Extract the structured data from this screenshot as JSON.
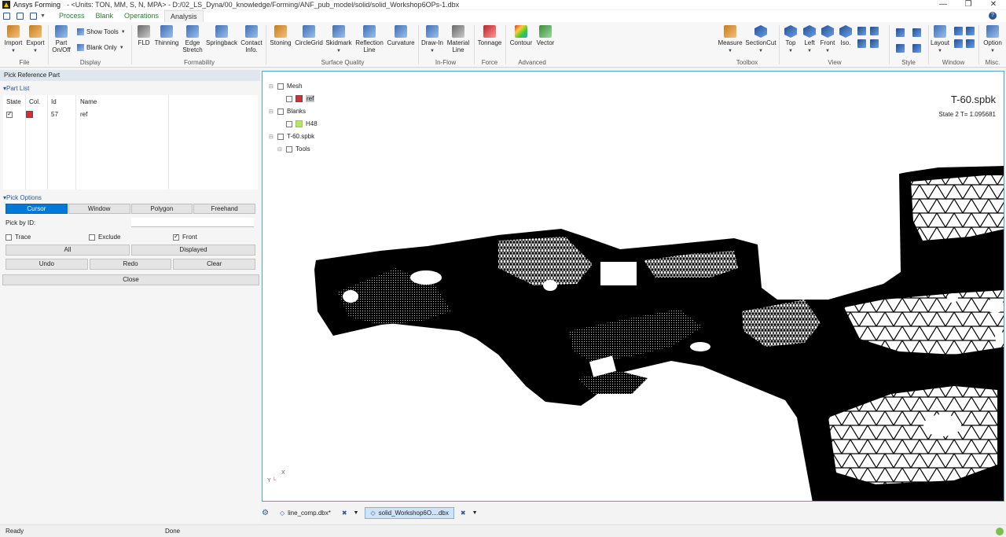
{
  "window": {
    "app_name": "Ansys Forming",
    "title_path": "- <Units: TON, MM, S, N, MPA> - D:/02_LS_Dyna/00_knowledge/Forming/ANF_pub_model/solid/solid_Workshop6OPs-1.dbx",
    "controls": [
      "—",
      "❐",
      "✕"
    ]
  },
  "menu": {
    "tabs": [
      "Process",
      "Blank",
      "Operations",
      "Analysis"
    ],
    "active_tab": "Analysis"
  },
  "ribbon": {
    "file": {
      "group": "File",
      "import": "Import",
      "export": "Export"
    },
    "display": {
      "group": "Display",
      "part_onoff_1": "Part",
      "part_onoff_2": "On/Off",
      "show_tools": "Show Tools",
      "blank_only": "Blank Only"
    },
    "formability": {
      "group": "Formability",
      "fld": "FLD",
      "thinning": "Thinning",
      "edge_stretch_1": "Edge",
      "edge_stretch_2": "Stretch",
      "springback": "Springback",
      "contact_1": "Contact",
      "contact_2": "Info."
    },
    "surface_quality": {
      "group": "Surface Quality",
      "stoning": "Stoning",
      "circlegrid": "CircleGrid",
      "skidmark": "Skidmark",
      "reflection_1": "Reflection",
      "reflection_2": "Line",
      "curvature": "Curvature"
    },
    "inflow": {
      "group": "In-Flow",
      "drawin": "Draw-In",
      "material_1": "Material",
      "material_2": "Line"
    },
    "force": {
      "group": "Force",
      "tonnage": "Tonnage"
    },
    "advanced": {
      "group": "Advanced",
      "contour": "Contour",
      "vector": "Vector"
    },
    "toolbox": {
      "group": "Toolbox",
      "measure": "Measure",
      "sectioncut": "SectionCut"
    },
    "view": {
      "group": "View",
      "top": "Top",
      "left": "Left",
      "front": "Front",
      "iso": "Iso."
    },
    "style": {
      "group": "Style"
    },
    "window_grp": {
      "group": "Window",
      "layout": "Layout"
    },
    "misc": {
      "group": "Misc.",
      "option": "Option"
    }
  },
  "left_panel": {
    "title": "Pick Reference Part",
    "part_list": {
      "header": "Part List",
      "columns": [
        "State",
        "Col.",
        "Id",
        "Name"
      ],
      "rows": [
        {
          "state_checked": true,
          "color": "#d32f2f",
          "id": "57",
          "name": "ref"
        }
      ]
    },
    "pick_options": {
      "header": "Pick Options",
      "modes": [
        "Cursor",
        "Window",
        "Polygon",
        "Freehand"
      ],
      "selected_mode": "Cursor",
      "pick_by_id_label": "Pick by ID:",
      "pick_by_id_value": "",
      "trace": {
        "label": "Trace",
        "checked": false
      },
      "exclude": {
        "label": "Exclude",
        "checked": false
      },
      "front": {
        "label": "Front",
        "checked": true
      },
      "all": "All",
      "displayed": "Displayed",
      "undo": "Undo",
      "redo": "Redo",
      "clear": "Clear"
    },
    "close": "Close"
  },
  "viewport": {
    "tree": {
      "mesh": "Mesh",
      "ref": "ref",
      "ref_color": "#d32f2f",
      "blanks": "Blanks",
      "h48": "H48",
      "h48_color": "#b7e36b",
      "spbk": "T-60.spbk",
      "tools": "Tools"
    },
    "model_name": "T-60.spbk",
    "state": "State 2   T= 1.095681",
    "axis_y": "Y",
    "axis_x": "X"
  },
  "doc_tabs": [
    {
      "label": "line_comp.dbx*",
      "active": false
    },
    {
      "label": "solid_Workshop6O....dbx",
      "active": true
    }
  ],
  "status": {
    "left": "Ready",
    "middle": "Done"
  }
}
